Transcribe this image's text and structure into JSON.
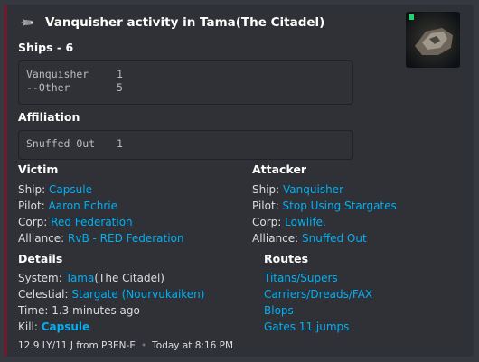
{
  "embed": {
    "accent_color": "#6b1c2e",
    "author": {
      "icon": "ship-icon",
      "text": "Vanquisher activity in Tama(The Citadel)"
    },
    "thumbnail": {
      "icon": "ship-thumbnail"
    },
    "ships": {
      "title": "Ships - 6",
      "rows": [
        {
          "name": "Vanquisher",
          "count": "1"
        },
        {
          "name": "--Other",
          "count": "5"
        }
      ]
    },
    "affiliation": {
      "title": "Affiliation",
      "rows": [
        {
          "name": "Snuffed Out",
          "count": "1"
        }
      ]
    },
    "victim": {
      "title": "Victim",
      "ship_label": "Ship:",
      "ship": "Capsule",
      "pilot_label": "Pilot:",
      "pilot": "Aaron Echrie",
      "corp_label": "Corp:",
      "corp": "Red Federation",
      "alliance_label": "Alliance:",
      "alliance": "RvB - RED Federation"
    },
    "attacker": {
      "title": "Attacker",
      "ship_label": "Ship:",
      "ship": "Vanquisher",
      "pilot_label": "Pilot:",
      "pilot": "Stop Using Stargates",
      "corp_label": "Corp:",
      "corp": "Lowlife.",
      "alliance_label": "Alliance:",
      "alliance": "Snuffed Out"
    },
    "details": {
      "title": "Details",
      "system_label": "System:",
      "system_link": "Tama",
      "system_region": "(The Citadel)",
      "celestial_label": "Celestial:",
      "celestial": "Stargate (Nourvukaiken)",
      "time_label": "Time:",
      "time": "1.3 minutes ago",
      "kill_label": "Kill:",
      "kill": "Capsule"
    },
    "routes": {
      "title": "Routes",
      "items": [
        "Titans/Supers",
        "Carriers/Dreads/FAX",
        "Blops",
        "Gates 11 jumps"
      ]
    },
    "footer": {
      "distance": "12.9 LY/11 J from P3EN-E",
      "separator": "•",
      "timestamp": "Today at 8:16 PM"
    }
  }
}
